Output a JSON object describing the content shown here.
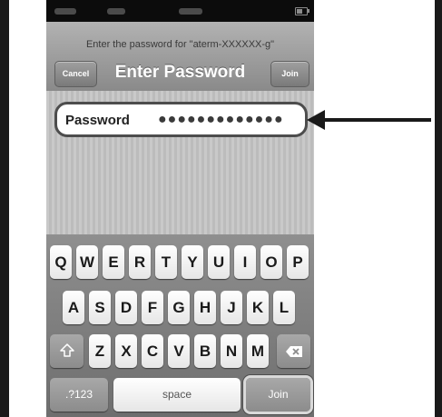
{
  "prompt": "Enter the password for \"aterm-XXXXXX-g\"",
  "nav": {
    "title": "Enter Password",
    "cancel_label": "Cancel",
    "join_label": "Join"
  },
  "password_field": {
    "label": "Password",
    "value": "●●●●●●●●●●●●●"
  },
  "keyboard": {
    "row1": [
      "Q",
      "W",
      "E",
      "R",
      "T",
      "Y",
      "U",
      "I",
      "O",
      "P"
    ],
    "row2": [
      "A",
      "S",
      "D",
      "F",
      "G",
      "H",
      "J",
      "K",
      "L"
    ],
    "row3": [
      "Z",
      "X",
      "C",
      "V",
      "B",
      "N",
      "M"
    ],
    "shift_icon": "shift-arrow-icon",
    "delete_icon": "backspace-icon",
    "numbers_label": ".?123",
    "space_label": "space",
    "join_label": "Join"
  },
  "colors": {
    "arrow": "#1a1a1a",
    "field_border": "#4d4d4d"
  }
}
